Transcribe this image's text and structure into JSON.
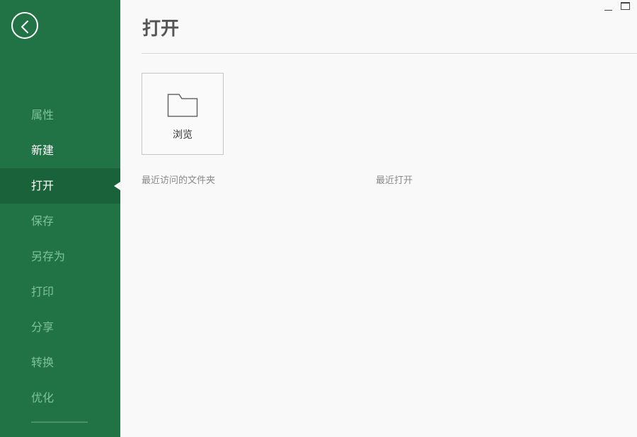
{
  "sidebar": {
    "items": [
      {
        "label": "属性",
        "state": "dim"
      },
      {
        "label": "新建",
        "state": "bright"
      },
      {
        "label": "打开",
        "state": "active"
      },
      {
        "label": "保存",
        "state": "dim"
      },
      {
        "label": "另存为",
        "state": "dim"
      },
      {
        "label": "打印",
        "state": "dim"
      },
      {
        "label": "分享",
        "state": "dim"
      },
      {
        "label": "转换",
        "state": "dim"
      },
      {
        "label": "优化",
        "state": "dim"
      }
    ]
  },
  "main": {
    "title": "打开",
    "browse_label": "浏览",
    "recent_folders_label": "最近访问的文件夹",
    "recent_open_label": "最近打开"
  },
  "icons": {
    "back": "arrow-left-circle-icon",
    "browse": "folder-icon",
    "minimize": "minimize-icon",
    "maximize": "maximize-icon"
  },
  "colors": {
    "sidebar_bg": "#217346",
    "sidebar_active_bg": "#1a6239",
    "sidebar_dim_text": "#7fc29b",
    "page_bg": "#f9f9f9"
  }
}
